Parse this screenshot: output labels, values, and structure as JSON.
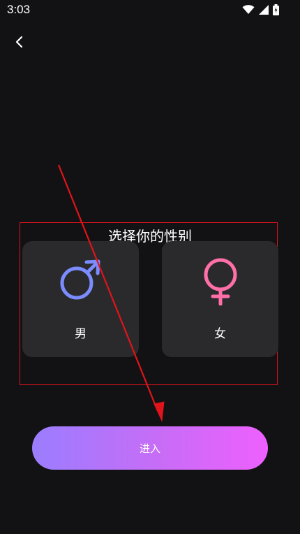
{
  "status_bar": {
    "time": "3:03",
    "icons": [
      "wifi-icon",
      "signal-icon",
      "battery-icon"
    ]
  },
  "nav": {
    "back_icon": "chevron-left-icon"
  },
  "gender_select": {
    "title": "选择你的性别",
    "options": [
      {
        "label": "男",
        "icon": "male-symbol-icon",
        "color": "#7b8cff"
      },
      {
        "label": "女",
        "icon": "female-symbol-icon",
        "color": "#ff6fa8"
      }
    ],
    "frame_color": "#e0141a"
  },
  "enter_button": {
    "label": "进入",
    "gradient": [
      "#9b7dff",
      "#ee60ff"
    ]
  },
  "annotation": {
    "color": "#e0141a"
  }
}
